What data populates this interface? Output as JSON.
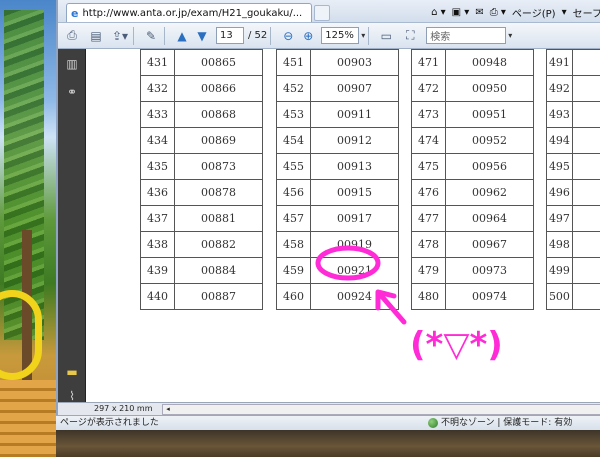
{
  "browser": {
    "tab_title": "http://www.anta.or.jp/exam/H21_goukaku/...",
    "page_menu": "ページ(P)",
    "safety_menu": "セーフ"
  },
  "pdf_toolbar": {
    "current_page": "13",
    "total_pages": "/ 52",
    "zoom": "125%",
    "search_placeholder": "検索"
  },
  "document": {
    "page_size": "297 x 210 mm",
    "columns": [
      {
        "nums": [
          "431",
          "432",
          "433",
          "434",
          "435",
          "436",
          "437",
          "438",
          "439",
          "440"
        ],
        "vals": [
          "00865",
          "00866",
          "00868",
          "00869",
          "00873",
          "00878",
          "00881",
          "00882",
          "00884",
          "00887"
        ]
      },
      {
        "nums": [
          "451",
          "452",
          "453",
          "454",
          "455",
          "456",
          "457",
          "458",
          "459",
          "460"
        ],
        "vals": [
          "00903",
          "00907",
          "00911",
          "00912",
          "00913",
          "00915",
          "00917",
          "00919",
          "00921",
          "00924"
        ]
      },
      {
        "nums": [
          "471",
          "472",
          "473",
          "474",
          "475",
          "476",
          "477",
          "478",
          "479",
          "480"
        ],
        "vals": [
          "00948",
          "00950",
          "00951",
          "00952",
          "00956",
          "00962",
          "00964",
          "00967",
          "00973",
          "00974"
        ]
      },
      {
        "nums": [
          "491",
          "492",
          "493",
          "494",
          "495",
          "496",
          "497",
          "498",
          "499",
          "500"
        ],
        "vals": [
          "",
          "",
          "",
          "",
          "",
          "",
          "",
          "",
          "",
          ""
        ]
      }
    ]
  },
  "statusbar": {
    "left_text": "ページが表示されました",
    "zone_text": "不明なゾーン | 保護モード: 有効"
  },
  "annotation": {
    "emoticon": "(*▽*)",
    "color": "#ff2bd6"
  }
}
